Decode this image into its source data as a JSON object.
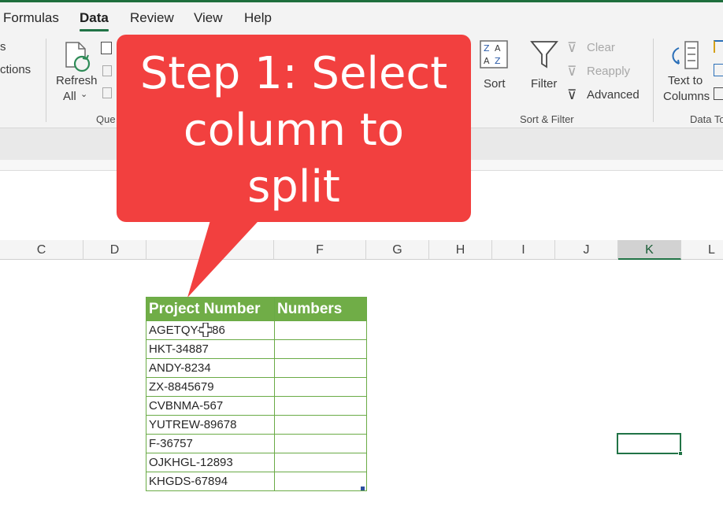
{
  "ribbon": {
    "tabs": [
      "Formulas",
      "Data",
      "Review",
      "View",
      "Help"
    ],
    "active_tab": "Data",
    "left_partial": [
      "s",
      "ctions"
    ],
    "refresh": {
      "line1": "Refresh",
      "line2": "All"
    },
    "queries_label_partial": "Que",
    "sort": "Sort",
    "filter": "Filter",
    "clear": "Clear",
    "reapply": "Reapply",
    "advanced": "Advanced",
    "sort_filter_label": "Sort & Filter",
    "text_to_columns": {
      "line1": "Text to",
      "line2": "Columns"
    },
    "data_tools_label_partial": "Data To"
  },
  "columns": [
    "C",
    "D",
    "F",
    "G",
    "H",
    "I",
    "J",
    "K",
    "L"
  ],
  "selected_column": "K",
  "table": {
    "headers": [
      "Project Number",
      "Numbers"
    ],
    "rows": [
      [
        "AGETQY-",
        "86"
      ],
      [
        "HKT-34887",
        ""
      ],
      [
        "ANDY-8234",
        ""
      ],
      [
        "ZX-8845679",
        ""
      ],
      [
        "CVBNMA-567",
        ""
      ],
      [
        "YUTREW-89678",
        ""
      ],
      [
        "F-36757",
        ""
      ],
      [
        "OJKHGL-12893",
        ""
      ],
      [
        "KHGDS-67894",
        ""
      ]
    ]
  },
  "callout": {
    "line1": "Step 1: Select",
    "line2": "column to",
    "line3": "split"
  },
  "colors": {
    "accent": "#217346",
    "header_fill": "#70ad47",
    "callout": "#f2403f"
  }
}
